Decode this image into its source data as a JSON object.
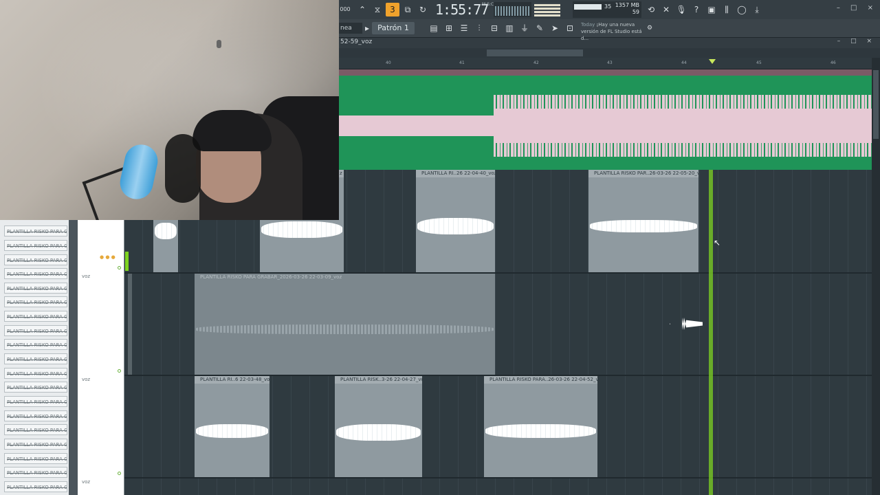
{
  "toolbar": {
    "time": "1:55:77",
    "time_unit": "M:S:CS",
    "mem_value": "1357 MB",
    "mem_cpu": "35",
    "mem_poly": "59",
    "window_controls": "– □ ×",
    "pattern": "Patrón 1",
    "mode": "nea",
    "bpm_partial": "000",
    "news_today": "Today",
    "news_text": "¡Hay una nueva versión de FL Studio está d..."
  },
  "playlist": {
    "title": "52-59_voz",
    "title_controls": "– □ ×",
    "ruler": [
      "40",
      "41",
      "42",
      "43",
      "44",
      "45",
      "46"
    ]
  },
  "left_panel": {
    "items": [
      "PLANTILLA RISKO PARA GR...",
      "PLANTILLA RISKO PARA GR...",
      "PLANTILLA RISKO PARA GR...",
      "PLANTILLA RISKO PARA GR...",
      "PLANTILLA RISKO PARA GR...",
      "PLANTILLA RISKO PARA GR...",
      "PLANTILLA RISKO PARA GR...",
      "PLANTILLA RISKO PARA GR...",
      "PLANTILLA RISKO PARA GR...",
      "PLANTILLA RISKO PARA GR...",
      "PLANTILLA RISKO PARA GR...",
      "PLANTILLA RISKO PARA GR...",
      "PLANTILLA RISKO PARA GR...",
      "PLANTILLA RISKO PARA GR...",
      "PLANTILLA RISKO PARA GR...",
      "PLANTILLA RISKO PARA GR...",
      "PLANTILLA RISKO PARA GR...",
      "PLANTILLA RISKO PARA GR...",
      "PLANTILLA RISKO PARA GR..."
    ]
  },
  "tracks": {
    "labels": [
      "voz",
      "voz",
      "voz"
    ]
  },
  "clips": {
    "c1": "PLANTILLA RI..26 22-04-40_voz",
    "c2": "PLANTILLA RISKO PAR..26-03-26 22-05-20_voz",
    "c3": "PLANTILLA RISKO PARA GRABAR_2026-03-26 22-03-09_voz",
    "c4": "PLANTILLA RI..6 22-03-48_voz",
    "c5": "PLANTILLA RISK..3-26 22-04-27_voz",
    "c6": "PLANTILLA RISKO PARA..26-03-26 22-04-52_voz",
    "c0": "z"
  },
  "colors": {
    "big_clip": "#1f9458",
    "wave_pink": "#e6c9d4",
    "accent": "#f0a22c",
    "playhead": "#7ed321"
  }
}
